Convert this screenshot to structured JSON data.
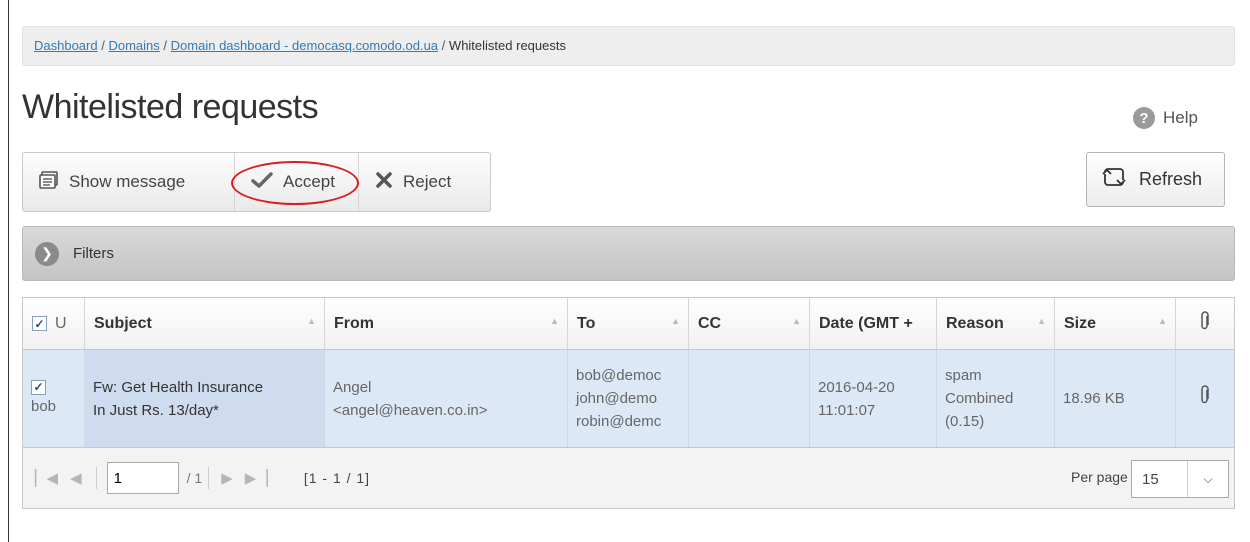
{
  "breadcrumb": {
    "items": [
      "Dashboard",
      "Domains",
      "Domain dashboard - democasq.comodo.od.ua"
    ],
    "separator": "/",
    "current": "Whitelisted requests"
  },
  "page_title": "Whitelisted requests",
  "help_label": "Help",
  "toolbar": {
    "show_message": "Show message",
    "accept": "Accept",
    "reject": "Reject"
  },
  "refresh_label": "Refresh",
  "filters_label": "Filters",
  "columns": [
    "U",
    "Subject",
    "From",
    "To",
    "CC",
    "Date (GMT +",
    "Reason",
    "Size"
  ],
  "row": {
    "user": "bob",
    "subject_line1": "Fw: Get Health Insurance",
    "subject_line2": "In Just Rs. 13/day*",
    "from_name": "Angel",
    "from_email": "<angel@heaven.co.in>",
    "to": [
      "bob@democ",
      "john@demo",
      "robin@demc"
    ],
    "cc": "",
    "date": "2016-04-20",
    "time": "11:01:07",
    "reason": [
      "spam",
      "Combined",
      "(0.15)"
    ],
    "size": "18.96 KB"
  },
  "pager": {
    "page": "1",
    "total": "/ 1",
    "range": "[1 - 1 / 1]",
    "per_page_label": "Per page",
    "per_page": "15"
  },
  "colors": {
    "accent_link": "#337ab7",
    "highlight_circle": "#d81e1e",
    "selected_row": "#dde8f7"
  }
}
